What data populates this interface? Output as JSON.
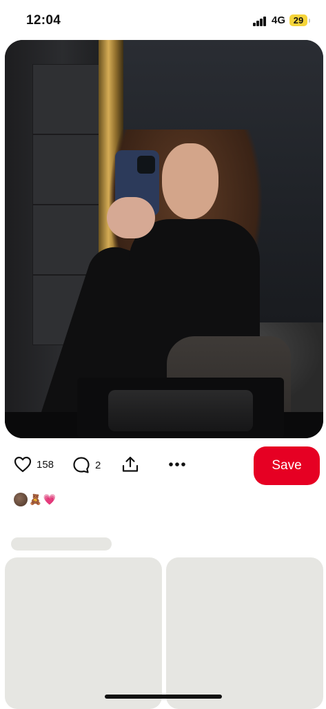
{
  "status_bar": {
    "time": "12:04",
    "network": "4G",
    "battery": "29",
    "battery_color": "#f5d43a"
  },
  "pin": {
    "image_icon": "photo-of-woman-taking-mirror-selfie"
  },
  "actions": {
    "like_icon": "heart-icon",
    "like_count": "158",
    "comment_icon": "speech-bubble-icon",
    "comment_count": "2",
    "share_icon": "share-upload-icon",
    "more_icon": "ellipsis-icon",
    "save_label": "Save",
    "save_color": "#e60023"
  },
  "reactions": {
    "emoji_bear": "🧸",
    "emoji_heart": "💗"
  },
  "colors": {
    "skeleton": "#e6e6e2"
  }
}
